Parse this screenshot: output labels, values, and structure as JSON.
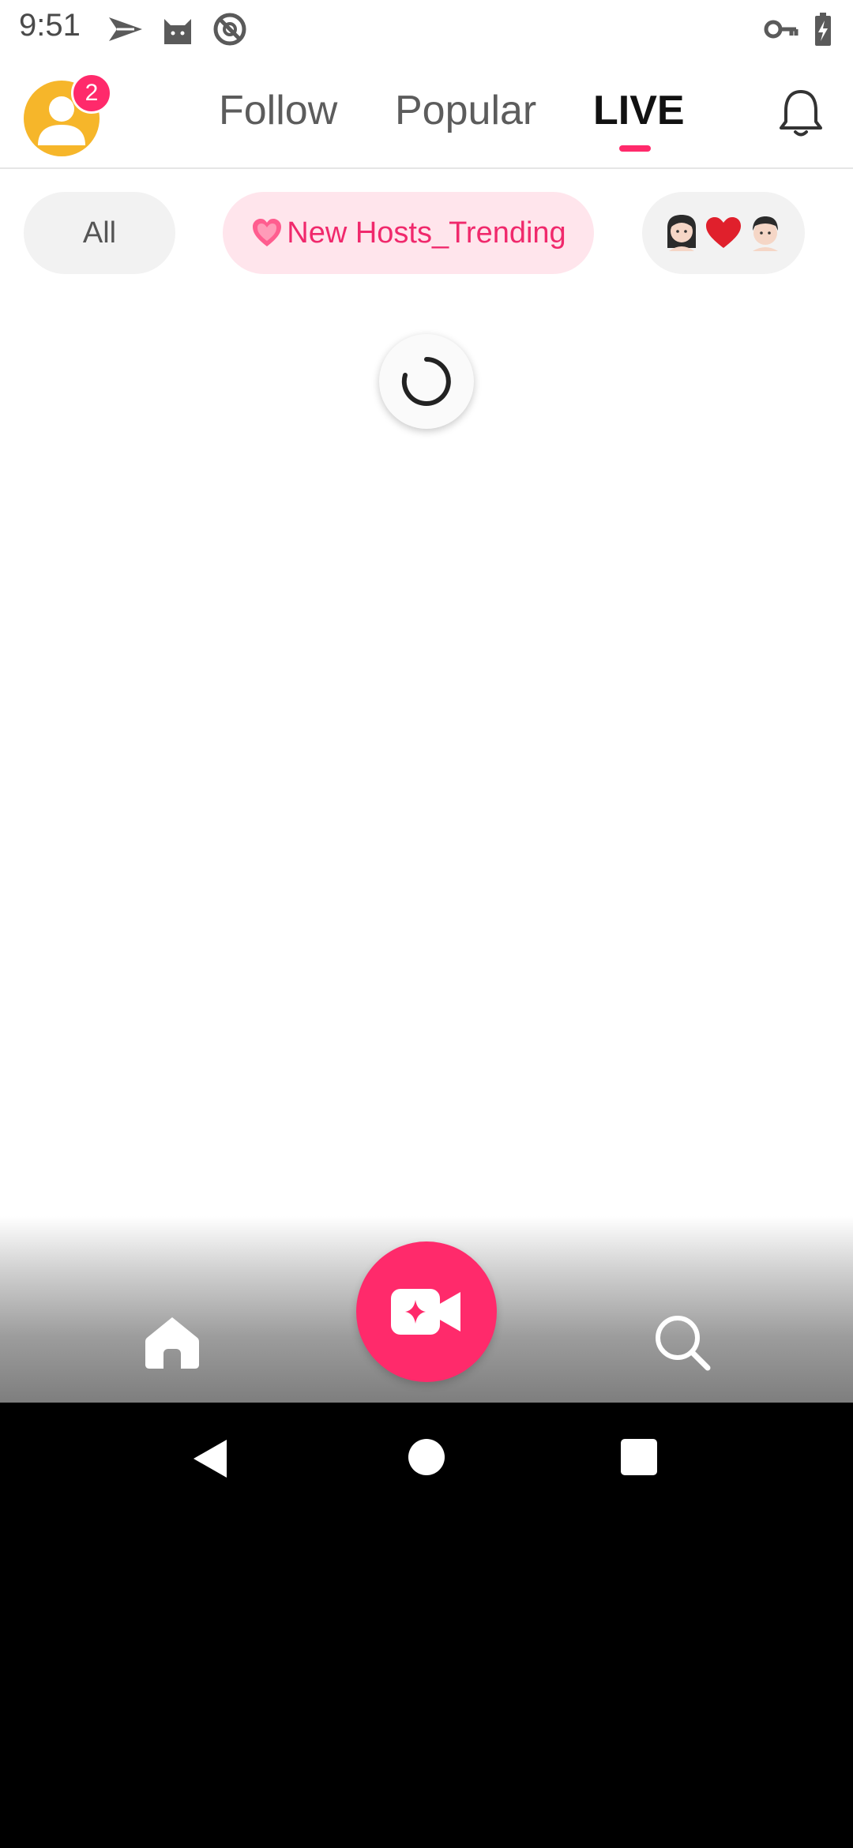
{
  "status_bar": {
    "time": "9:51",
    "icons": [
      "send-icon",
      "cat-icon",
      "no-tracking-icon",
      "vpn-key-icon",
      "battery-charging-icon"
    ]
  },
  "header": {
    "notification_count": "2",
    "tabs": [
      {
        "label": "Follow",
        "active": false
      },
      {
        "label": "Popular",
        "active": false
      },
      {
        "label": "LIVE",
        "active": true
      }
    ],
    "bell_icon": "bell-icon"
  },
  "filters": [
    {
      "label": "All",
      "selected": false
    },
    {
      "label": "New Hosts_Trending",
      "icon": "pink-heart-icon",
      "selected": true
    },
    {
      "label": "",
      "icons": [
        "woman-emoji-icon",
        "red-heart-icon",
        "man-emoji-icon"
      ],
      "selected": false
    }
  ],
  "content": {
    "loading": true
  },
  "bottom_nav": {
    "items": [
      "home-icon",
      "go-live-camera-icon",
      "search-icon"
    ]
  },
  "colors": {
    "accent": "#ff2a6b",
    "chip_selected_bg": "#ffe5ec",
    "avatar": "#f6b62a"
  }
}
